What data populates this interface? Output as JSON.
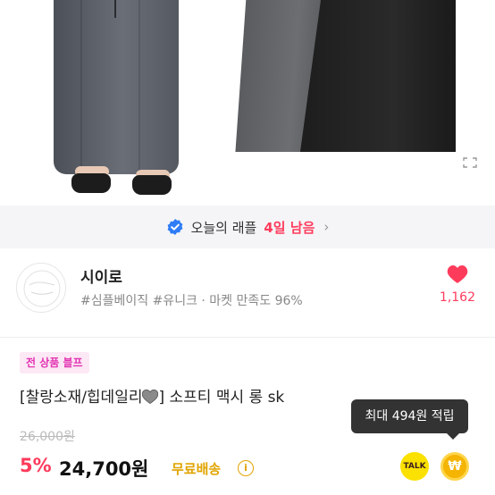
{
  "banner": {
    "text": "오늘의 래플",
    "highlight": "4일 남음",
    "chevron": "›"
  },
  "shop": {
    "name": "시이로",
    "tags": "#심플베이직 #유니크 · 마켓 만족도 96%",
    "likes": "1,162",
    "heart_color": "#ff3b5c"
  },
  "product": {
    "promo_badge": "전 상품 블프",
    "title_prefix": "[찰랑소재/힙데일리",
    "title_suffix": "] 소프티 맥시 롱 sk",
    "original_price": "26,000원",
    "discount": "5%",
    "price": "24,700원",
    "shipping": "무료배송",
    "info_icon": "i"
  },
  "tooltip": {
    "text": "최대 494원 적립"
  },
  "actions": {
    "talk_label": "TALK",
    "won_label": "₩"
  },
  "icons": {
    "verified": "check-badge-icon",
    "heart": "heart-icon",
    "expand": "expand-icon"
  },
  "colors": {
    "accent": "#ff3b5c",
    "promo_bg": "#fde8f6",
    "promo_text": "#e234b2",
    "shipping": "#e0a400",
    "kakao": "#fae100"
  }
}
